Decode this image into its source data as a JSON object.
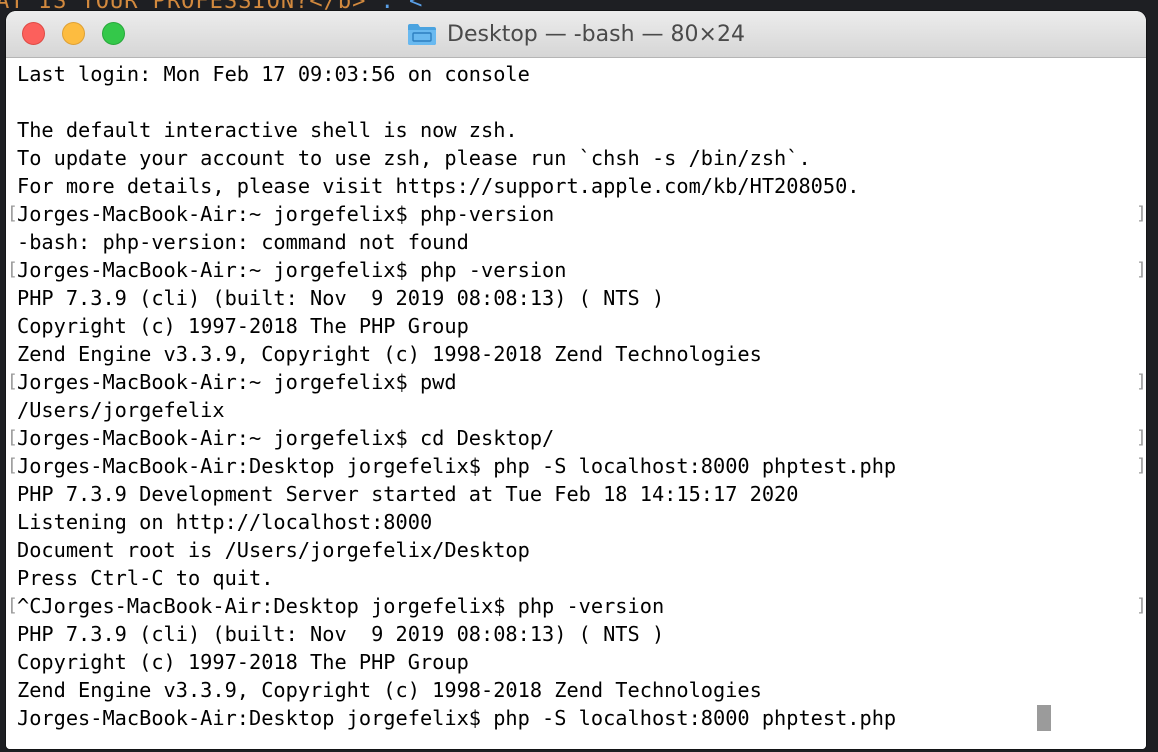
{
  "background": {
    "text_a": "AT IS YOUR PROFESSION?</b>",
    "text_b": "`: <",
    "text_color": "#d2893e",
    "selection_color": "#5aa0e8"
  },
  "window": {
    "title": "Desktop — -bash — 80×24",
    "icon": "folder-icon"
  },
  "terminal": {
    "lines": [
      "Last login: Mon Feb 17 09:03:56 on console",
      "",
      "The default interactive shell is now zsh.",
      "To update your account to use zsh, please run `chsh -s /bin/zsh`.",
      "For more details, please visit https://support.apple.com/kb/HT208050.",
      "Jorges-MacBook-Air:~ jorgefelix$ php-version",
      "-bash: php-version: command not found",
      "Jorges-MacBook-Air:~ jorgefelix$ php -version",
      "PHP 7.3.9 (cli) (built: Nov  9 2019 08:08:13) ( NTS )",
      "Copyright (c) 1997-2018 The PHP Group",
      "Zend Engine v3.3.9, Copyright (c) 1998-2018 Zend Technologies",
      "Jorges-MacBook-Air:~ jorgefelix$ pwd",
      "/Users/jorgefelix",
      "Jorges-MacBook-Air:~ jorgefelix$ cd Desktop/",
      "Jorges-MacBook-Air:Desktop jorgefelix$ php -S localhost:8000 phptest.php",
      "PHP 7.3.9 Development Server started at Tue Feb 18 14:15:17 2020",
      "Listening on http://localhost:8000",
      "Document root is /Users/jorgefelix/Desktop",
      "Press Ctrl-C to quit.",
      "^CJorges-MacBook-Air:Desktop jorgefelix$ php -version",
      "PHP 7.3.9 (cli) (built: Nov  9 2019 08:08:13) ( NTS )",
      "Copyright (c) 1997-2018 The PHP Group",
      "Zend Engine v3.3.9, Copyright (c) 1998-2018 Zend Technologies",
      "Jorges-MacBook-Air:Desktop jorgefelix$ php -S localhost:8000 phptest.php"
    ],
    "marked_lines": [
      5,
      7,
      11,
      13,
      14,
      19
    ],
    "mark_left": "[",
    "mark_right": "]",
    "cursor_line": 23
  }
}
